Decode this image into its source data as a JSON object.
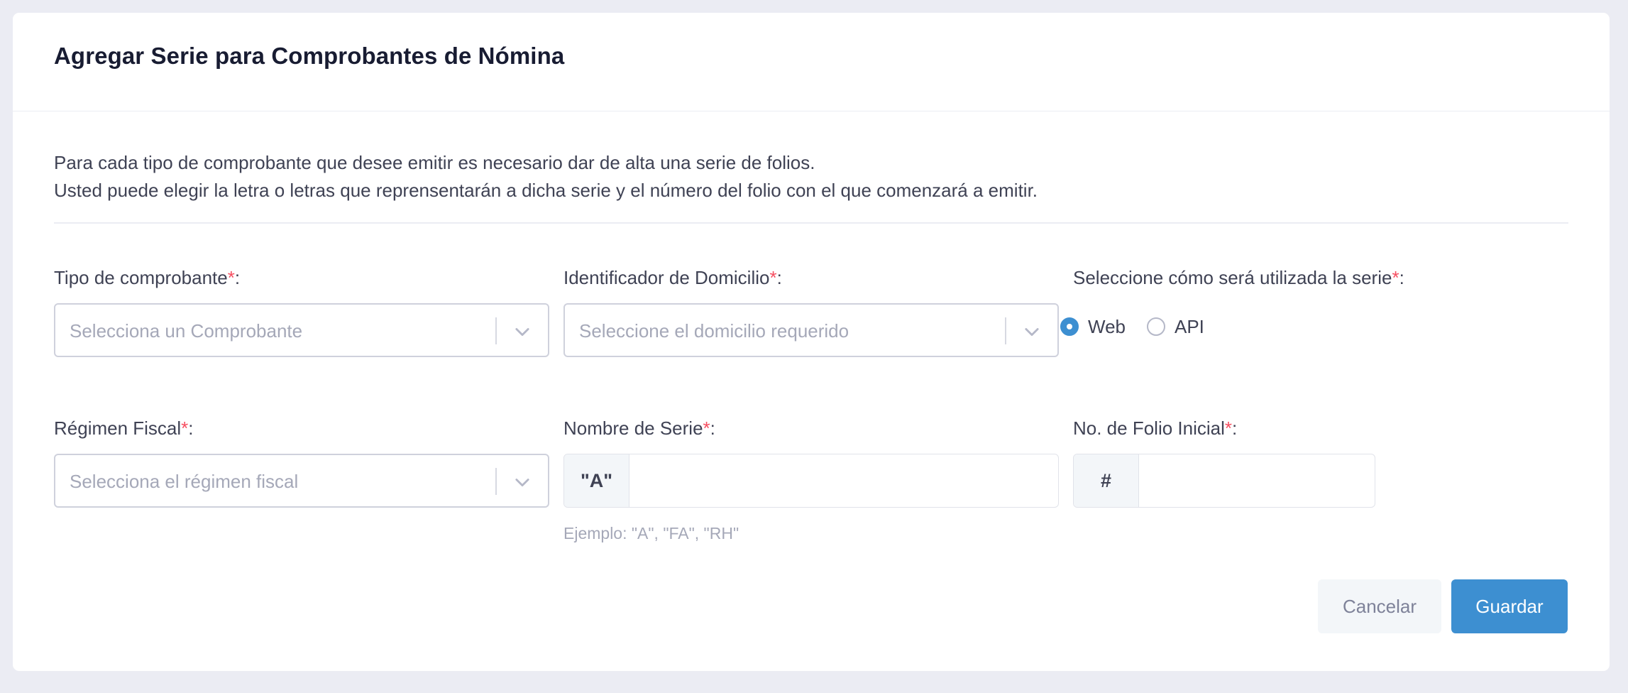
{
  "title": "Agregar Serie para Comprobantes de Nómina",
  "intro": {
    "line1": "Para cada tipo de comprobante que desee emitir es necesario dar de alta una serie de folios.",
    "line2": "Usted puede elegir la letra o letras que reprensentarán a dicha serie y el número del folio con el que comenzará a emitir."
  },
  "fields": {
    "tipo_comprobante": {
      "label": "Tipo de comprobante",
      "placeholder": "Selecciona un Comprobante"
    },
    "domicilio": {
      "label": "Identificador de Domicilio",
      "placeholder": "Seleccione el domicilio requerido"
    },
    "uso_serie": {
      "label": "Seleccione cómo será utilizada la serie",
      "options": [
        "Web",
        "API"
      ],
      "selected": "Web"
    },
    "regimen": {
      "label": "Régimen Fiscal",
      "placeholder": "Selecciona el régimen fiscal"
    },
    "nombre_serie": {
      "label": "Nombre de Serie",
      "addon": "\"A\"",
      "value": "",
      "hint": "Ejemplo: \"A\", \"FA\", \"RH\""
    },
    "folio_inicial": {
      "label": "No. de Folio Inicial",
      "addon": "#",
      "value": ""
    }
  },
  "required_marker": "*",
  "label_suffix": ":",
  "buttons": {
    "cancel": "Cancelar",
    "save": "Guardar"
  },
  "colors": {
    "primary": "#3d8fd1",
    "required": "#f64e60",
    "background": "#ebecf3"
  },
  "icons": {
    "select_caret": "chevron-down-icon"
  }
}
